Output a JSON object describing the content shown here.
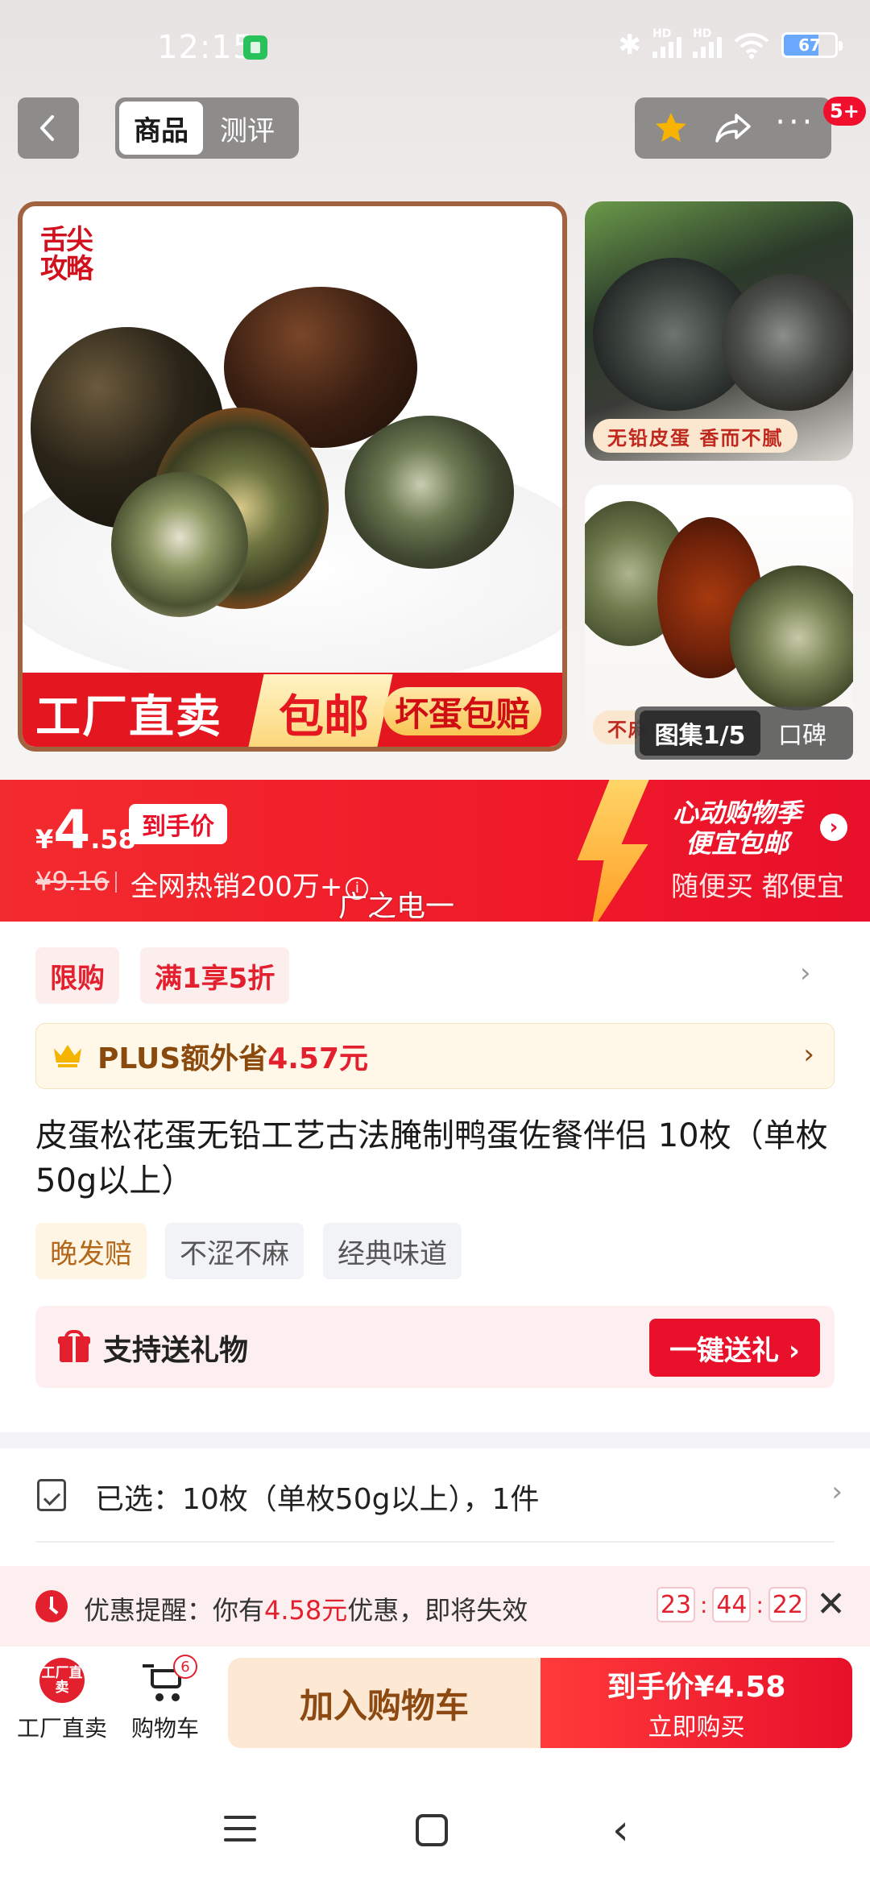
{
  "status_bar": {
    "time": "12:15",
    "signal_label": "HD",
    "battery_level": "67"
  },
  "header": {
    "tabs": [
      {
        "label": "商品",
        "active": true
      },
      {
        "label": "测评",
        "active": false
      }
    ],
    "cart_badge": "5+",
    "icons": [
      "back-icon",
      "star-icon",
      "share-icon",
      "more-icon"
    ]
  },
  "gallery": {
    "brand_logo": "舌尖攻略",
    "banner_factory": "工厂直卖",
    "banner_free_shipping": "包邮",
    "banner_guarantee": "坏蛋包赔",
    "thumb1_tag": "无铅皮蛋 香而不腻",
    "thumb2_tag": "不麻不涩 鲜美",
    "counter": "图集1/5",
    "reviews_label": "口碑"
  },
  "price_banner": {
    "currency": "¥",
    "price_int": "4",
    "price_dec": ".58",
    "price_tag": "到手价",
    "original_price": "¥9.16",
    "sales": "全网热销200万+",
    "promo_line1": "心动购物季",
    "promo_line2": "便宜包邮",
    "promo_sub": "随便买 都便宜",
    "overlay_text": "广之电一",
    "accent_color": "#f01a2a"
  },
  "promos": {
    "tag1": "限购",
    "tag2": "满1享5折"
  },
  "plus": {
    "prefix": "PLUS额外省",
    "amount": "4.57元"
  },
  "product": {
    "title": "皮蛋松花蛋无铅工艺古法腌制鸭蛋佐餐伴侣 10枚（单枚50g以上）",
    "features": [
      "晚发赔",
      "不涩不麻",
      "经典味道"
    ]
  },
  "gift": {
    "label": "支持送礼物",
    "button": "一键送礼 ›"
  },
  "selected": {
    "text": "已选：10枚（单枚50g以上），1件"
  },
  "reminder": {
    "prefix": "优惠提醒：你有",
    "amount": "4.58元",
    "suffix": "优惠，即将失效",
    "countdown": [
      "23",
      "44",
      "22"
    ]
  },
  "bottom_bar": {
    "factory_icon_text": "工厂直卖",
    "factory_label": "工厂直卖",
    "cart_label": "购物车",
    "cart_count": "6",
    "add_to_cart": "加入购物车",
    "buy_price": "到手价¥4.58",
    "buy_now": "立即购买"
  }
}
